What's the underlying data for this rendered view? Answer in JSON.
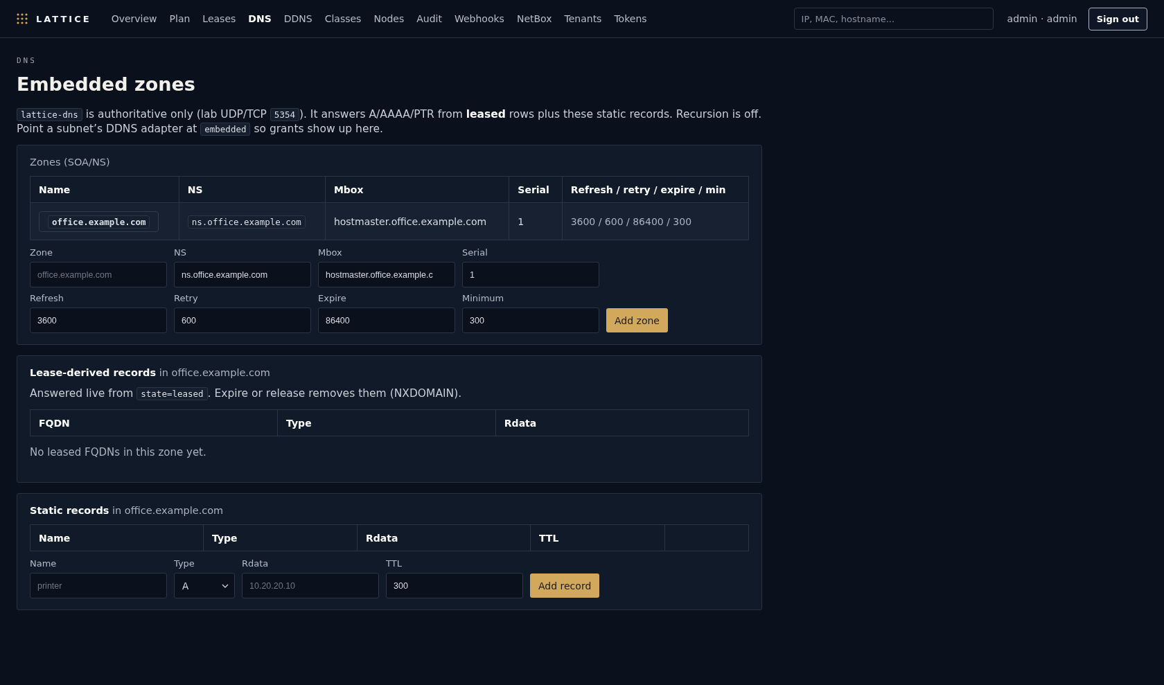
{
  "nav": {
    "brand": "LATTICE",
    "items": [
      {
        "label": "Overview",
        "selected": false
      },
      {
        "label": "Plan",
        "selected": false
      },
      {
        "label": "Leases",
        "selected": false
      },
      {
        "label": "DNS",
        "selected": true
      },
      {
        "label": "DDNS",
        "selected": false
      },
      {
        "label": "Classes",
        "selected": false
      },
      {
        "label": "Nodes",
        "selected": false
      },
      {
        "label": "Audit",
        "selected": false
      },
      {
        "label": "Webhooks",
        "selected": false
      },
      {
        "label": "NetBox",
        "selected": false
      },
      {
        "label": "Tenants",
        "selected": false
      },
      {
        "label": "Tokens",
        "selected": false
      }
    ],
    "search": {
      "placeholder": "IP, MAC, hostname..."
    },
    "user": "admin · admin",
    "sign_out": "Sign out"
  },
  "eyebrow": "DNS",
  "title": "Embedded zones",
  "intro": [
    {
      "kind": "code",
      "text": "lattice-dns"
    },
    {
      "kind": "plain",
      "text": " is authoritative only (lab UDP/TCP "
    },
    {
      "kind": "code",
      "text": "5354"
    },
    {
      "kind": "plain",
      "text": "). It answers A/AAAA/PTR from **leased** rows plus these static records. Recursion is off."
    },
    {
      "kind": "break"
    },
    {
      "kind": "plain",
      "text": "Point a subnet’s DDNS adapter at "
    },
    {
      "kind": "code",
      "text": "embedded"
    },
    {
      "kind": "plain",
      "text": " so grants show up here."
    }
  ],
  "zones": {
    "title": "Zones (SOA/NS)",
    "columns": [
      "Name",
      "NS",
      "Mbox",
      "Serial",
      "Refresh / retry / expire / min"
    ],
    "rows": [
      {
        "name": "office.example.com",
        "ns": "ns.office.example.com",
        "mbox": "hostmaster.office.example.com",
        "serial": "1",
        "timers": "3600 / 600 / 86400 / 300"
      }
    ],
    "form": [
      {
        "label": "Zone",
        "placeholder": "office.example.com"
      },
      {
        "label": "NS",
        "value": "ns.office.example.com"
      },
      {
        "label": "Mbox",
        "value": "hostmaster.office.example.c"
      },
      {
        "label": "Serial",
        "value": "1"
      },
      {
        "label": "Refresh",
        "value": "3600"
      },
      {
        "label": "Retry",
        "value": "600"
      },
      {
        "label": "Expire",
        "value": "86400"
      },
      {
        "label": "Minimum",
        "value": "300"
      }
    ],
    "button": "Add zone"
  },
  "lease_records": {
    "title": "**Lease-derived records** in office.example.com",
    "note": [
      {
        "kind": "plain",
        "text": "Answered live from "
      },
      {
        "kind": "code",
        "text": "state=leased"
      },
      {
        "kind": "plain",
        "text": ". Expire or release removes them (NXDOMAIN)."
      }
    ],
    "columns": [
      "FQDN",
      "Type",
      "Rdata"
    ],
    "empty": "No leased FQDNs in this zone yet."
  },
  "static_records": {
    "title": "**Static records** in office.example.com",
    "columns": [
      "Name",
      "Type",
      "Rdata",
      "TTL"
    ],
    "form": [
      {
        "kind": "input",
        "label": "Name",
        "placeholder": "printer"
      },
      {
        "kind": "select",
        "label": "Type",
        "value": "A"
      },
      {
        "kind": "input",
        "label": "Rdata",
        "placeholder": "10.20.20.10"
      },
      {
        "kind": "input",
        "label": "TTL",
        "value": "300"
      }
    ],
    "button": "Add record"
  }
}
